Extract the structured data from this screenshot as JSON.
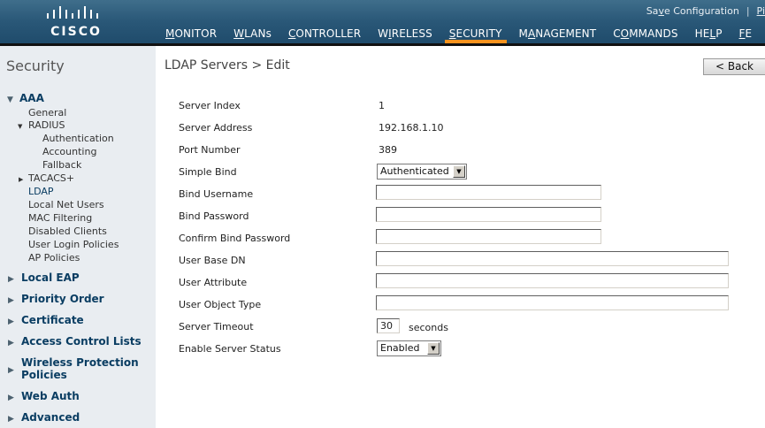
{
  "header": {
    "brand": "CISCO",
    "top_links": [
      "Save Configuration",
      "Pi"
    ],
    "nav": [
      {
        "label": "MONITOR",
        "ul": "M",
        "rest": "ONITOR"
      },
      {
        "label": "WLANs",
        "ul": "W",
        "rest": "LANs"
      },
      {
        "label": "CONTROLLER",
        "ul": "C",
        "rest": "ONTROLLER"
      },
      {
        "label": "WIRELESS",
        "pre": "W",
        "ul": "I",
        "rest": "RELESS"
      },
      {
        "label": "SECURITY",
        "ul": "S",
        "rest": "ECURITY",
        "active": true
      },
      {
        "label": "MANAGEMENT",
        "pre": "M",
        "ul": "A",
        "rest": "NAGEMENT"
      },
      {
        "label": "COMMANDS",
        "pre": "C",
        "ul": "O",
        "rest": "MMANDS"
      },
      {
        "label": "HELP",
        "pre": "HE",
        "ul": "L",
        "rest": "P"
      },
      {
        "label": "FE",
        "ul": "F",
        "rest": "E"
      }
    ],
    "accent_color": "#f7931e"
  },
  "sidebar": {
    "title": "Security",
    "aaa": {
      "label": "AAA",
      "general": "General",
      "radius": "RADIUS",
      "radius_items": [
        "Authentication",
        "Accounting",
        "Fallback"
      ],
      "tacacs": "TACACS+",
      "items": [
        "LDAP",
        "Local Net Users",
        "MAC Filtering",
        "Disabled Clients",
        "User Login Policies",
        "AP Policies"
      ]
    },
    "sections": [
      "Local EAP",
      "Priority Order",
      "Certificate",
      "Access Control Lists",
      "Wireless Protection",
      "Web Auth",
      "Advanced"
    ],
    "wireless_protection_line2": "Policies"
  },
  "main": {
    "title": "LDAP Servers > Edit",
    "back_label": "< Back",
    "labels": {
      "server_index": "Server Index",
      "server_address": "Server Address",
      "port_number": "Port Number",
      "simple_bind": "Simple Bind",
      "bind_username": "Bind Username",
      "bind_password": "Bind Password",
      "confirm_bind_password": "Confirm Bind Password",
      "user_base_dn": "User Base DN",
      "user_attribute": "User Attribute",
      "user_object_type": "User Object Type",
      "server_timeout": "Server Timeout",
      "enable_server_status": "Enable Server Status"
    },
    "values": {
      "server_index": "1",
      "server_address": "192.168.1.10",
      "port_number": "389",
      "simple_bind": "Authenticated",
      "bind_username": "",
      "bind_password": "",
      "confirm_bind_password": "",
      "user_base_dn": "",
      "user_attribute": "",
      "user_object_type": "",
      "server_timeout": "30",
      "server_timeout_unit": "seconds",
      "enable_server_status": "Enabled"
    }
  }
}
